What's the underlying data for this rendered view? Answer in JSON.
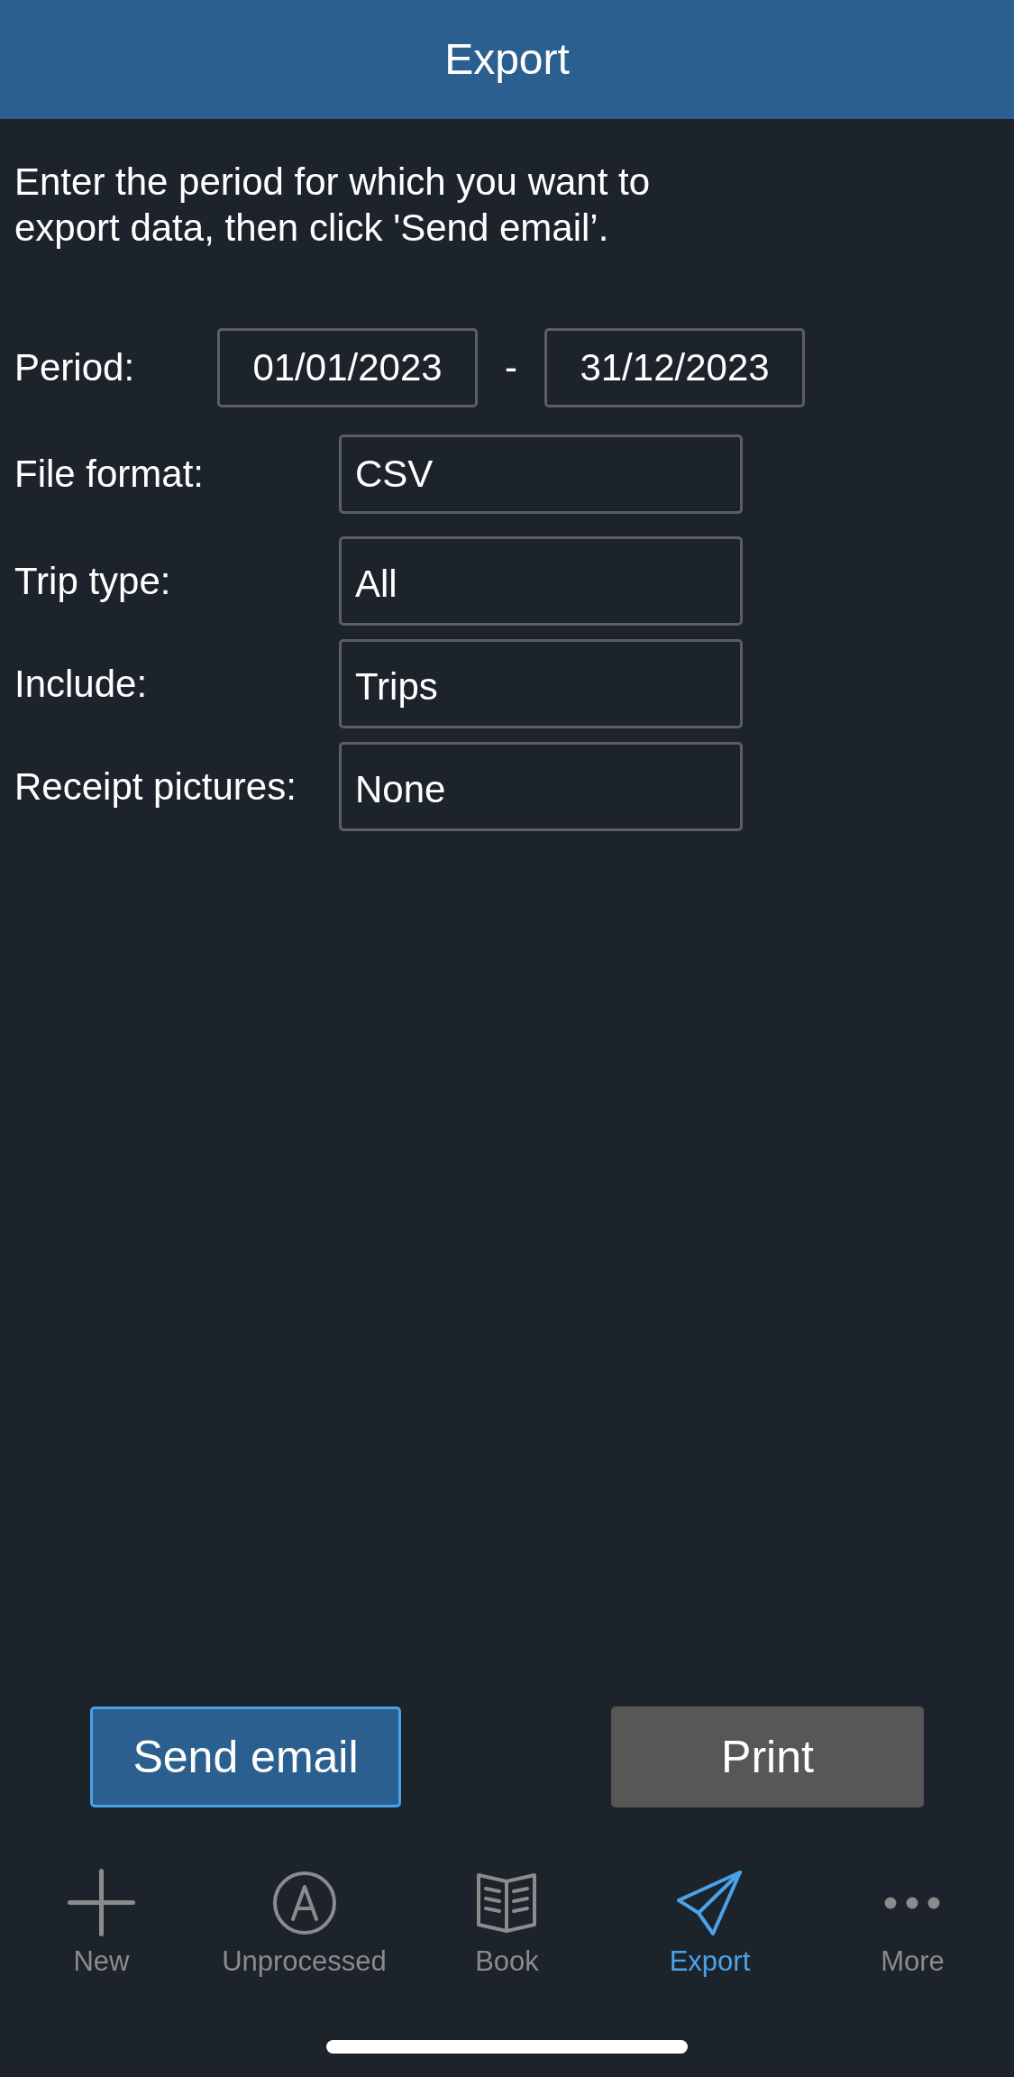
{
  "header": {
    "title": "Export"
  },
  "instructions": "Enter the period for which you want to export data, then click 'Send email’.",
  "period": {
    "label": "Period:",
    "start": "01/01/2023",
    "separator": "-",
    "end": "31/12/2023"
  },
  "fields": [
    {
      "label": "File format:",
      "value": "CSV"
    },
    {
      "label": "Trip type:",
      "value": "All"
    },
    {
      "label": "Include:",
      "value": "Trips"
    },
    {
      "label": "Receipt pictures:",
      "value": "None"
    }
  ],
  "buttons": [
    {
      "label": "Send email",
      "kind": "primary"
    },
    {
      "label": "Print",
      "kind": "secondary"
    }
  ],
  "tab_bar": {
    "tabs": [
      {
        "label": "New",
        "selected": false
      },
      {
        "label": "Unprocessed",
        "selected": false
      },
      {
        "label": "Book",
        "selected": false
      },
      {
        "label": "Export",
        "selected": true
      },
      {
        "label": "More",
        "selected": false
      }
    ]
  }
}
